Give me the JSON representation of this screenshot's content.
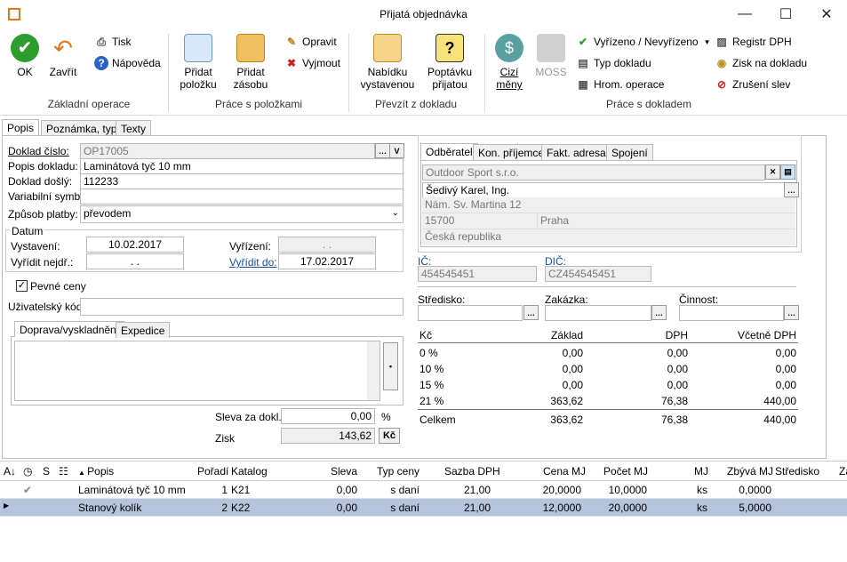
{
  "window": {
    "title": "Přijatá objednávka"
  },
  "ribbon": {
    "ok": "OK",
    "close": "Zavřít",
    "print": "Tisk",
    "help": "Nápověda",
    "group1": "Základní operace",
    "add_item": "Přidat položku",
    "add_stock": "Přidat zásobu",
    "edit": "Opravit",
    "cut": "Vyjmout",
    "group2": "Práce s položkami",
    "offer": "Nabídku vystavenou",
    "inquiry": "Poptávku přijatou",
    "group3": "Převzít z dokladu",
    "currency": "Cizí měny",
    "moss": "MOSS",
    "settled": "Vyřízeno / Nevyřízeno",
    "doctype": "Typ dokladu",
    "bulk": "Hrom. operace",
    "group4": "Práce s dokladem",
    "vat_reg": "Registr DPH",
    "profit": "Zisk na dokladu",
    "cancel_disc": "Zrušení slev"
  },
  "tabs": [
    "Popis",
    "Poznámka, typ",
    "Texty"
  ],
  "form": {
    "doc_no_label": "Doklad číslo:",
    "doc_no": "OP17005",
    "desc_label": "Popis dokladu:",
    "desc": "Laminátová tyč 10 mm",
    "recv_label": "Doklad došlý:",
    "recv": "112233",
    "vs_label": "Variabilní symbol:",
    "vs": "",
    "pay_label": "Způsob platby:",
    "pay": "převodem",
    "date_group": "Datum",
    "issued_label": "Vystavení:",
    "issued": "10.02.2017",
    "due_label": "Vyřídit nejdř.:",
    "due": ". .",
    "settle_label": "Vyřízení:",
    "settle": ". .",
    "settle_by_label": "Vyřídit do:",
    "settle_by": "17.02.2017",
    "fixed_prices": "Pevné ceny",
    "user_code_label": "Uživatelský kód:",
    "user_code": "",
    "subtab1": "Doprava/vyskladnění",
    "subtab2": "Expedice",
    "disc_label": "Sleva za dokl.:",
    "disc": "0,00",
    "disc_unit": "%",
    "profit_label": "Zisk",
    "profit": "143,62",
    "profit_btn": "Kč"
  },
  "partner": {
    "tabs": [
      "Odběratel",
      "Kon. příjemce",
      "Fakt. adresa",
      "Spojení"
    ],
    "company": "Outdoor Sport s.r.o.",
    "person": "Šedivý Karel, Ing.",
    "street": "Nám. Sv. Martina 12",
    "zip": "15700",
    "city": "Praha",
    "country": "Česká republika",
    "ic_label": "IČ:",
    "ic": "454545451",
    "dic_label": "DIČ:",
    "dic": "CZ454545451",
    "center_label": "Středisko:",
    "order_label": "Zakázka:",
    "activity_label": "Činnost:"
  },
  "vat": {
    "headers": [
      "Kč",
      "Základ",
      "DPH",
      "Včetně DPH"
    ],
    "rows": [
      [
        "0 %",
        "0,00",
        "0,00",
        "0,00"
      ],
      [
        "10 %",
        "0,00",
        "0,00",
        "0,00"
      ],
      [
        "15 %",
        "0,00",
        "0,00",
        "0,00"
      ],
      [
        "21 %",
        "363,62",
        "76,38",
        "440,00"
      ]
    ],
    "total": [
      "Celkem",
      "363,62",
      "76,38",
      "440,00"
    ]
  },
  "grid": {
    "headers": [
      "S",
      "Popis",
      "Pořadí",
      "Katalog",
      "Sleva",
      "Typ ceny",
      "Sazba DPH",
      "Cena MJ",
      "Počet MJ",
      "MJ",
      "Zbývá MJ",
      "Středisko",
      "Za"
    ],
    "rows": [
      [
        "Laminátová tyč 10 mm",
        "1",
        "K21",
        "0,00",
        "s daní",
        "21,00",
        "20,0000",
        "10,0000",
        "ks",
        "0,0000"
      ],
      [
        "Stanový kolík",
        "2",
        "K22",
        "0,00",
        "s daní",
        "21,00",
        "12,0000",
        "20,0000",
        "ks",
        "5,0000"
      ]
    ]
  },
  "colors": {
    "accent": "#1a4fa0",
    "selected_row": "#b4c4dc",
    "ok_green": "#2e9c2e"
  }
}
